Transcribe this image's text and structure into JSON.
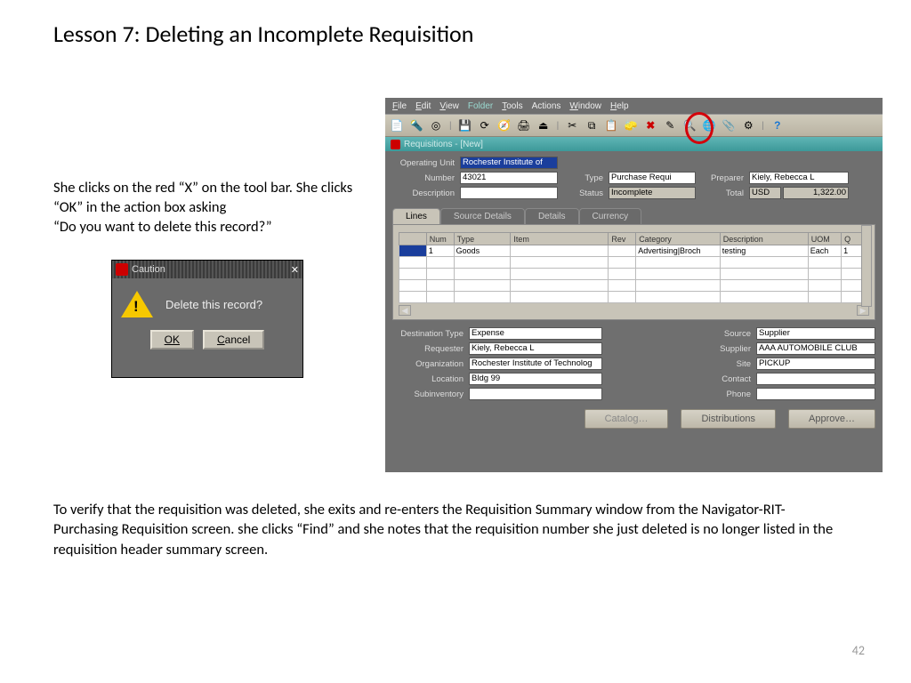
{
  "title": "Lesson 7:  Deleting an Incomplete Requisition",
  "intro": {
    "line1": "She clicks on the red “X” on the tool bar. She clicks",
    "line2": "“OK” in the action box asking",
    "line3": " “Do you want to delete this record?”"
  },
  "caution": {
    "title": "Caution",
    "message": "Delete this record?",
    "ok": "OK",
    "cancel": "Cancel"
  },
  "app": {
    "menu": {
      "file": "File",
      "edit": "Edit",
      "view": "View",
      "folder": "Folder",
      "tools": "Tools",
      "actions": "Actions",
      "window": "Window",
      "help": "Help"
    },
    "subwin": "Requisitions - [New]",
    "labels": {
      "operating_unit": "Operating Unit",
      "number": "Number",
      "description": "Description",
      "type": "Type",
      "status": "Status",
      "preparer": "Preparer",
      "total": "Total"
    },
    "fields": {
      "operating_unit": "Rochester Institute of",
      "number": "43021",
      "description": "",
      "type": "Purchase Requi",
      "status": "Incomplete",
      "preparer": "Kiely, Rebecca L",
      "total_currency": "USD",
      "total_amount": "1,322.00"
    },
    "tabs": {
      "lines": "Lines",
      "source_details": "Source Details",
      "details": "Details",
      "currency": "Currency"
    },
    "grid": {
      "headers": {
        "num": "Num",
        "type": "Type",
        "item": "Item",
        "rev": "Rev",
        "category": "Category",
        "description": "Description",
        "uom": "UOM",
        "q": "Q"
      },
      "row1": {
        "num": "1",
        "type": "Goods",
        "item": "",
        "rev": "",
        "category": "Advertising|Broch",
        "description": "testing",
        "uom": "Each",
        "q": "1"
      }
    },
    "footer": {
      "labels": {
        "destination_type": "Destination Type",
        "requester": "Requester",
        "organization": "Organization",
        "location": "Location",
        "subinventory": "Subinventory",
        "source": "Source",
        "supplier": "Supplier",
        "site": "Site",
        "contact": "Contact",
        "phone": "Phone"
      },
      "fields": {
        "destination_type": "Expense",
        "requester": "Kiely, Rebecca L",
        "organization": "Rochester Institute of Technolog",
        "location": "Bldg 99",
        "subinventory": "",
        "source": "Supplier",
        "supplier": "AAA AUTOMOBILE CLUB",
        "site": "PICKUP",
        "contact": "",
        "phone": ""
      }
    },
    "buttons": {
      "catalog": "Catalog…",
      "distributions": "Distributions",
      "approve": "Approve…"
    }
  },
  "verify_para": "To verify that the requisition was deleted, she exits and re-enters the Requisition Summary window from the Navigator-RIT-Purchasing Requisition screen.  she clicks “Find” and she notes that the requisition number she just deleted is no longer listed in the requisition header summary screen.",
  "page_number": "42"
}
